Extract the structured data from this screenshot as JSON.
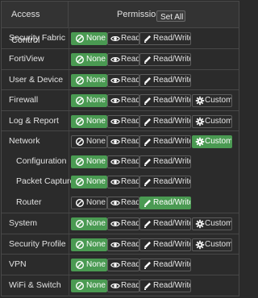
{
  "header": {
    "access_control": "Access Control",
    "permissions": "Permissions",
    "set_all": "Set All"
  },
  "button_labels": {
    "none": "None",
    "read": "Read",
    "read_write": "Read/Write",
    "custom": "Custom"
  },
  "colors": {
    "active": "#4a9a52",
    "background": "#2b2b2b",
    "header": "#333333"
  },
  "rows": [
    {
      "label": "Security Fabric",
      "selected": "None",
      "custom": false,
      "sub": false
    },
    {
      "label": "FortiView",
      "selected": "None",
      "custom": false,
      "sub": false
    },
    {
      "label": "User & Device",
      "selected": "None",
      "custom": false,
      "sub": false
    },
    {
      "label": "Firewall",
      "selected": "None",
      "custom": true,
      "sub": false
    },
    {
      "label": "Log & Report",
      "selected": "None",
      "custom": true,
      "sub": false
    },
    {
      "label": "Network",
      "selected": "Custom",
      "custom": true,
      "sub": false
    },
    {
      "label": "Configuration",
      "selected": "None",
      "custom": false,
      "sub": true
    },
    {
      "label": "Packet Capture",
      "selected": "None",
      "custom": false,
      "sub": true
    },
    {
      "label": "Router",
      "selected": "Read/Write",
      "custom": false,
      "sub": true
    },
    {
      "label": "System",
      "selected": "None",
      "custom": true,
      "sub": false
    },
    {
      "label": "Security Profile",
      "selected": "None",
      "custom": true,
      "sub": false
    },
    {
      "label": "VPN",
      "selected": "None",
      "custom": false,
      "sub": false
    },
    {
      "label": "WiFi & Switch",
      "selected": "None",
      "custom": false,
      "sub": false
    }
  ]
}
